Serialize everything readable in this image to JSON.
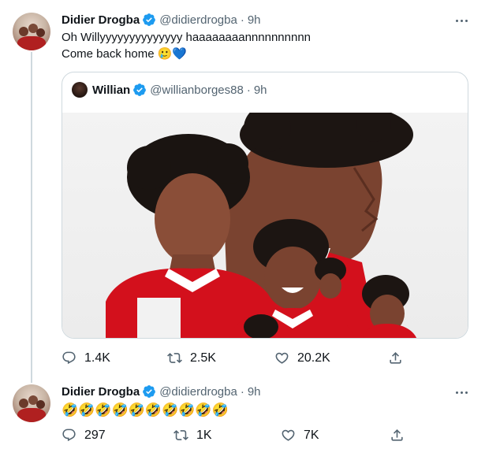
{
  "tweet1": {
    "display_name": "Didier Drogba",
    "handle": "@didierdrogba",
    "time": "9h",
    "line1": "Oh Willyyyyyyyyyyyyyy haaaaaaaannnnnnnnnn",
    "line2": "Come back home",
    "line2_emoji": "🥲💙",
    "quote": {
      "display_name": "Willian",
      "handle": "@willianborges88",
      "time": "9h"
    },
    "stats": {
      "replies": "1.4K",
      "retweets": "2.5K",
      "likes": "20.2K"
    }
  },
  "tweet2": {
    "display_name": "Didier Drogba",
    "handle": "@didierdrogba",
    "time": "9h",
    "text": "🤣🤣🤣🤣🤣🤣🤣🤣🤣🤣",
    "stats": {
      "replies": "297",
      "retweets": "1K",
      "likes": "7K"
    }
  },
  "separator_dot": "·",
  "colors": {
    "verified": "#1d9bf0",
    "arsenal_red": "#d3101c",
    "muted": "#536471"
  }
}
